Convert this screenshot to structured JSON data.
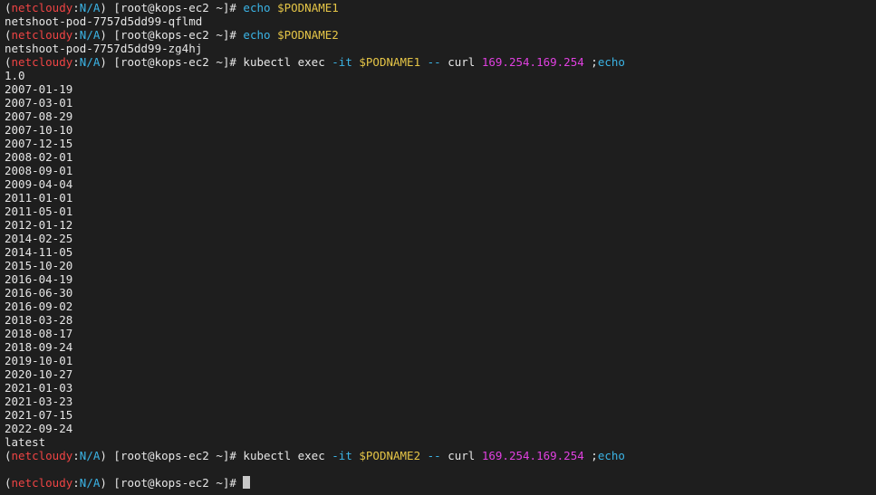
{
  "prompt": {
    "open_paren": "(",
    "context": "netcloudy",
    "colon": ":",
    "namespace": "N/A",
    "close_paren": ")",
    "user_host": " [root@kops-ec2 ~]# "
  },
  "lines": [
    {
      "type": "prompt",
      "segments": [
        {
          "text": "echo ",
          "cls": "c-cyan"
        },
        {
          "text": "$PODNAME1",
          "cls": "c-yellow"
        }
      ]
    },
    {
      "type": "output",
      "text": "netshoot-pod-7757d5dd99-qflmd"
    },
    {
      "type": "prompt",
      "segments": [
        {
          "text": "echo ",
          "cls": "c-cyan"
        },
        {
          "text": "$PODNAME2",
          "cls": "c-yellow"
        }
      ]
    },
    {
      "type": "output",
      "text": "netshoot-pod-7757d5dd99-zg4hj"
    },
    {
      "type": "prompt",
      "segments": [
        {
          "text": "kubectl exec ",
          "cls": "c-white"
        },
        {
          "text": "-it ",
          "cls": "c-cyan"
        },
        {
          "text": "$PODNAME1",
          "cls": "c-yellow"
        },
        {
          "text": " -- ",
          "cls": "c-cyan"
        },
        {
          "text": "curl ",
          "cls": "c-white"
        },
        {
          "text": "169.254.169.254",
          "cls": "c-magenta"
        },
        {
          "text": " ;",
          "cls": "c-white"
        },
        {
          "text": "echo",
          "cls": "c-cyan"
        }
      ]
    },
    {
      "type": "output",
      "text": "1.0"
    },
    {
      "type": "output",
      "text": "2007-01-19"
    },
    {
      "type": "output",
      "text": "2007-03-01"
    },
    {
      "type": "output",
      "text": "2007-08-29"
    },
    {
      "type": "output",
      "text": "2007-10-10"
    },
    {
      "type": "output",
      "text": "2007-12-15"
    },
    {
      "type": "output",
      "text": "2008-02-01"
    },
    {
      "type": "output",
      "text": "2008-09-01"
    },
    {
      "type": "output",
      "text": "2009-04-04"
    },
    {
      "type": "output",
      "text": "2011-01-01"
    },
    {
      "type": "output",
      "text": "2011-05-01"
    },
    {
      "type": "output",
      "text": "2012-01-12"
    },
    {
      "type": "output",
      "text": "2014-02-25"
    },
    {
      "type": "output",
      "text": "2014-11-05"
    },
    {
      "type": "output",
      "text": "2015-10-20"
    },
    {
      "type": "output",
      "text": "2016-04-19"
    },
    {
      "type": "output",
      "text": "2016-06-30"
    },
    {
      "type": "output",
      "text": "2016-09-02"
    },
    {
      "type": "output",
      "text": "2018-03-28"
    },
    {
      "type": "output",
      "text": "2018-08-17"
    },
    {
      "type": "output",
      "text": "2018-09-24"
    },
    {
      "type": "output",
      "text": "2019-10-01"
    },
    {
      "type": "output",
      "text": "2020-10-27"
    },
    {
      "type": "output",
      "text": "2021-01-03"
    },
    {
      "type": "output",
      "text": "2021-03-23"
    },
    {
      "type": "output",
      "text": "2021-07-15"
    },
    {
      "type": "output",
      "text": "2022-09-24"
    },
    {
      "type": "output",
      "text": "latest"
    },
    {
      "type": "prompt",
      "segments": [
        {
          "text": "kubectl exec ",
          "cls": "c-white"
        },
        {
          "text": "-it ",
          "cls": "c-cyan"
        },
        {
          "text": "$PODNAME2",
          "cls": "c-yellow"
        },
        {
          "text": " -- ",
          "cls": "c-cyan"
        },
        {
          "text": "curl ",
          "cls": "c-white"
        },
        {
          "text": "169.254.169.254",
          "cls": "c-magenta"
        },
        {
          "text": " ;",
          "cls": "c-white"
        },
        {
          "text": "echo",
          "cls": "c-cyan"
        }
      ]
    },
    {
      "type": "output",
      "text": ""
    },
    {
      "type": "prompt",
      "segments": [],
      "cursor": true
    }
  ],
  "colors": {
    "background": "#1e1e1e",
    "foreground": "#e6e6e6",
    "context": "#ef4444",
    "namespace": "#3bb4e6",
    "command": "#3bb4e6",
    "variable": "#e5c547",
    "ip_address": "#e040e0",
    "cursor": "#c8c8c8"
  }
}
